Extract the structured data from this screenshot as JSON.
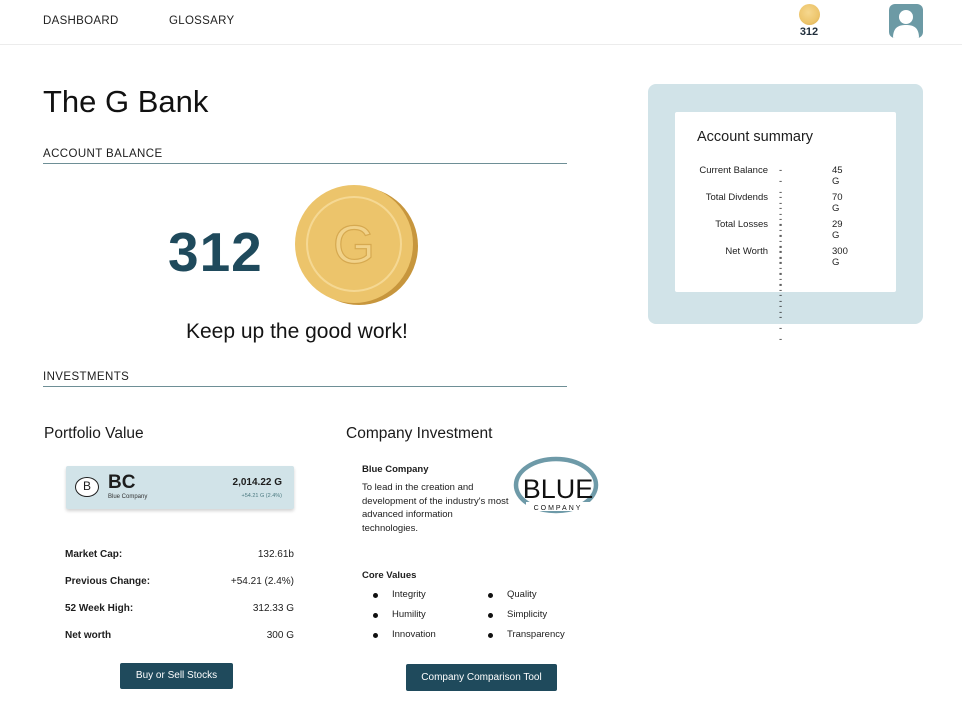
{
  "nav": {
    "dashboard": "DASHBOARD",
    "glossary": "GLOSSARY",
    "coin_count": "312"
  },
  "bank_name": "The G Bank",
  "account_balance": {
    "heading": "ACCOUNT BALANCE",
    "amount": "312",
    "coin_letter": "G",
    "message": "Keep up the good work!"
  },
  "investments": {
    "heading": "INVESTMENTS",
    "portfolio": {
      "title": "Portfolio Value",
      "stock": {
        "badge": "B",
        "ticker": "BC",
        "company": "Blue Company",
        "value": "2,014.22 G",
        "change": "+54.21 G (2.4%)"
      },
      "stats": [
        {
          "label": "Market Cap:",
          "value": "132.61b"
        },
        {
          "label": "Previous Change:",
          "value": "+54.21 (2.4%)"
        },
        {
          "label": "52 Week High:",
          "value": "312.33 G"
        },
        {
          "label": "Net worth",
          "value": "300 G"
        }
      ],
      "button": "Buy or Sell Stocks"
    },
    "company": {
      "title": "Company Investment",
      "name": "Blue Company",
      "description": "To lead in the creation and development of the industry's most advanced information technologies.",
      "logo_word": "BLUE",
      "logo_sub": "COMPANY",
      "core_values_title": "Core Values",
      "core_values": [
        "Integrity",
        "Quality",
        "Humility",
        "Simplicity",
        "Innovation",
        "Transparency"
      ],
      "button": "Company Comparison Tool"
    }
  },
  "account_summary": {
    "title": "Account summary",
    "rows": [
      {
        "label": "Current Balance",
        "dash": "---------",
        "value": "45 G"
      },
      {
        "label": "Total Divdends",
        "dash": "---------",
        "value": "70 G"
      },
      {
        "label": "Total Losses",
        "dash": "---------",
        "value": "29 G"
      },
      {
        "label": "Net Worth",
        "dash": "---------",
        "value": "300 G"
      }
    ]
  },
  "colors": {
    "accent_dark": "#1f4a5c",
    "panel_light": "#d1e3e8",
    "coin_gold": "#edc56c"
  }
}
